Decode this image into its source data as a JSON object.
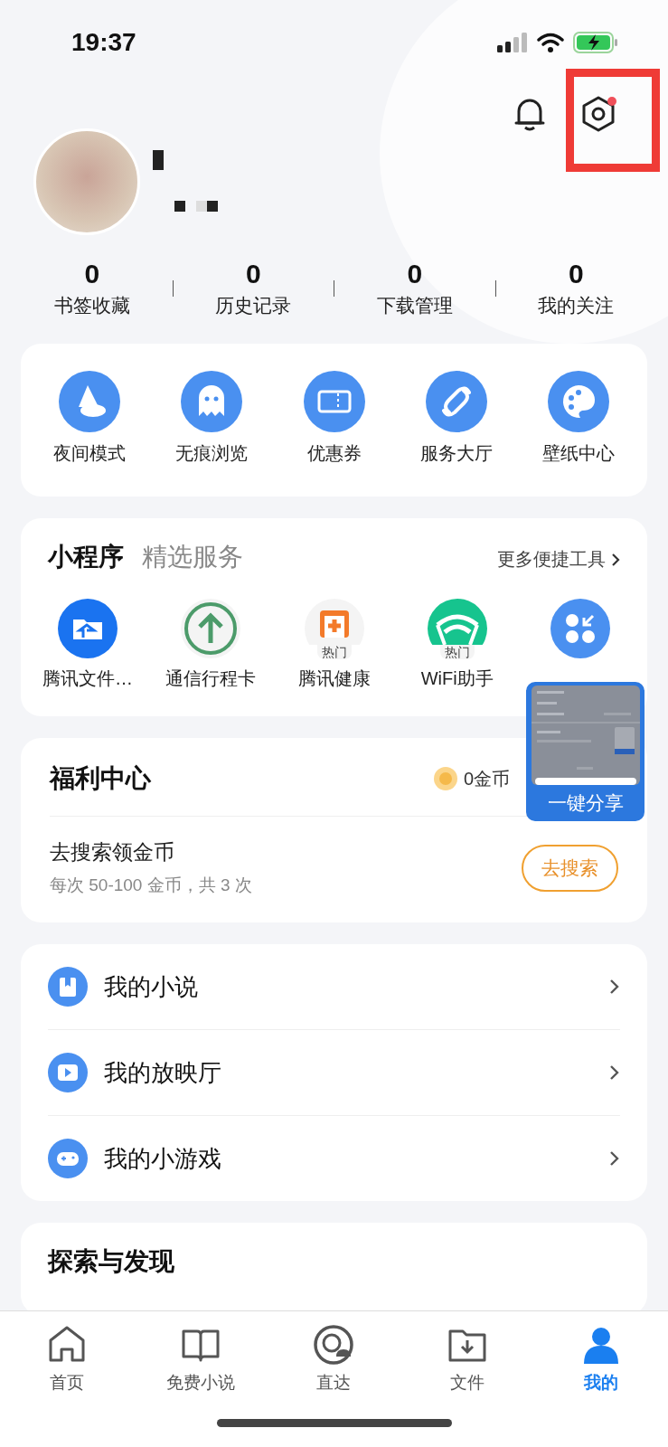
{
  "status_bar": {
    "time": "19:37"
  },
  "header": {
    "settings_dot": true
  },
  "stats": [
    {
      "value": "0",
      "label": "书签收藏"
    },
    {
      "value": "0",
      "label": "历史记录"
    },
    {
      "value": "0",
      "label": "下载管理"
    },
    {
      "value": "0",
      "label": "我的关注"
    }
  ],
  "quick_tools": [
    {
      "label": "夜间模式"
    },
    {
      "label": "无痕浏览"
    },
    {
      "label": "优惠券"
    },
    {
      "label": "服务大厅"
    },
    {
      "label": "壁纸中心"
    }
  ],
  "mini_programs": {
    "title": "小程序",
    "subtitle": "精选服务",
    "more": "更多便捷工具",
    "items": [
      {
        "label": "腾讯文件…"
      },
      {
        "label": "通信行程卡"
      },
      {
        "label": "腾讯健康",
        "badge": "热门"
      },
      {
        "label": "WiFi助手",
        "badge": "热门"
      }
    ]
  },
  "welfare": {
    "title": "福利中心",
    "coins": "0金币",
    "task": {
      "title": "去搜索领金币",
      "detail": "每次 50-100 金币，共 3 次",
      "button": "去搜索"
    }
  },
  "my_list": [
    {
      "label": "我的小说"
    },
    {
      "label": "我的放映厅"
    },
    {
      "label": "我的小游戏"
    }
  ],
  "discover": {
    "title": "探索与发现"
  },
  "share_widget": {
    "label": "一键分享"
  },
  "tab_bar": [
    {
      "label": "首页",
      "selected": false
    },
    {
      "label": "免费小说",
      "selected": false
    },
    {
      "label": "直达",
      "selected": false
    },
    {
      "label": "文件",
      "selected": false
    },
    {
      "label": "我的",
      "selected": true
    }
  ]
}
